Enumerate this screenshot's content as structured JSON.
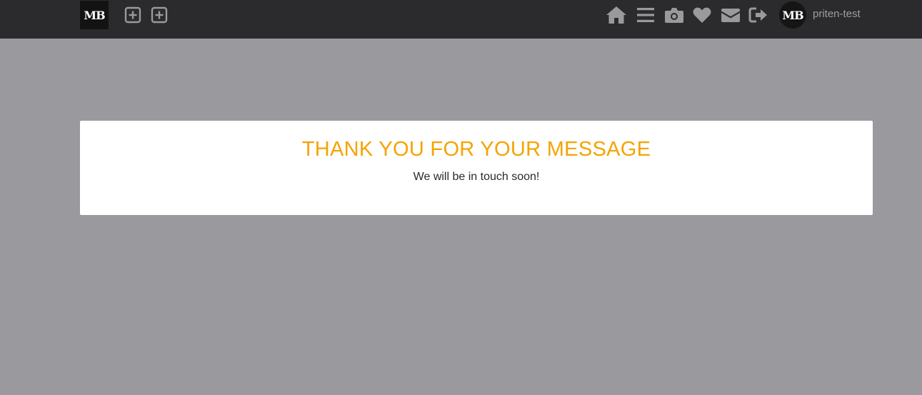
{
  "navbar": {
    "logo_text": "MB",
    "left_icons": [
      "plus-square-icon",
      "plus-square-icon"
    ],
    "right_icons": [
      "home-icon",
      "menu-icon",
      "camera-icon",
      "heart-icon",
      "envelope-icon",
      "sign-out-icon"
    ],
    "avatar_text": "MB",
    "username": "priten-test"
  },
  "message": {
    "title": "THANK YOU FOR YOUR MESSAGE",
    "body": "We will be in touch soon!"
  },
  "colors": {
    "navbar_bg": "#2b2b2d",
    "page_bg": "#9a999e",
    "icon": "#9a999e",
    "title_accent": "#f5a300"
  }
}
